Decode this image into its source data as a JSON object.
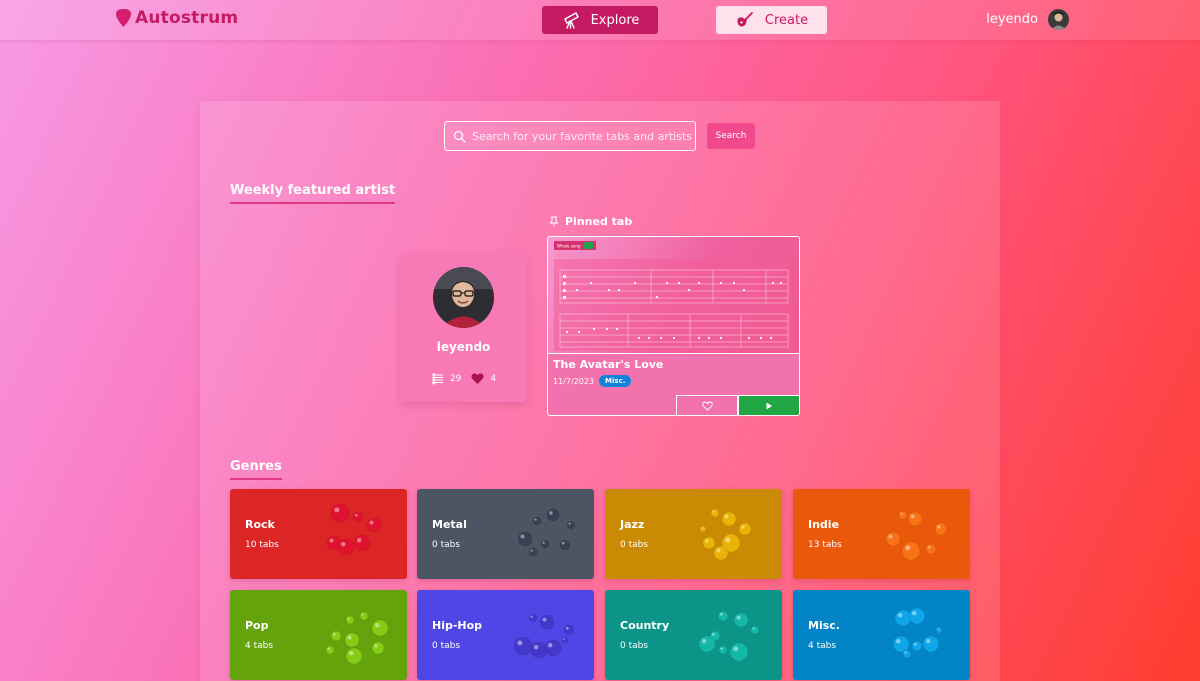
{
  "nav": {
    "brand": "Autostrum",
    "explore_label": "Explore",
    "create_label": "Create",
    "username": "leyendo"
  },
  "search": {
    "placeholder": "Search for your favorite tabs and artists",
    "button_label": "Search"
  },
  "featured": {
    "section_title": "Weekly featured artist",
    "artist": {
      "name": "leyendo",
      "tabs_count": "29",
      "likes_count": "4"
    },
    "pinned_label": "Pinned tab",
    "pinned_tab": {
      "title": "The Avatar's Love",
      "date": "11/7/2023",
      "genre_badge": "Misc.",
      "preview_label": "Whole song"
    }
  },
  "genres": {
    "section_title": "Genres",
    "items": [
      {
        "name": "Rock",
        "count": "10 tabs",
        "color": "#dc2626",
        "bubble": "#e0122f"
      },
      {
        "name": "Metal",
        "count": "0 tabs",
        "color": "#4b5563",
        "bubble": "#374151"
      },
      {
        "name": "Jazz",
        "count": "0 tabs",
        "color": "#ca8a04",
        "bubble": "#eab308"
      },
      {
        "name": "Indie",
        "count": "13 tabs",
        "color": "#ea580c",
        "bubble": "#f97316"
      },
      {
        "name": "Pop",
        "count": "4 tabs",
        "color": "#65a30d",
        "bubble": "#84cc16"
      },
      {
        "name": "Hip-Hop",
        "count": "0 tabs",
        "color": "#4f46e5",
        "bubble": "#4338ca"
      },
      {
        "name": "Country",
        "count": "0 tabs",
        "color": "#0d9488",
        "bubble": "#14b8a6"
      },
      {
        "name": "Misc.",
        "count": "4 tabs",
        "color": "#0284c7",
        "bubble": "#0ea5e9"
      }
    ]
  }
}
